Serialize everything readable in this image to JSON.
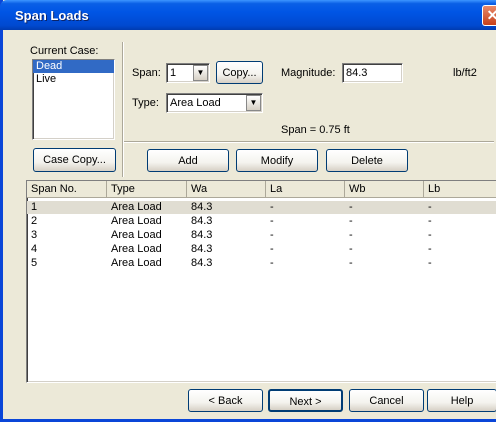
{
  "window": {
    "title": "Span Loads",
    "close_glyph": "✕"
  },
  "case": {
    "label": "Current Case:",
    "items": [
      "Dead",
      "Live"
    ],
    "selected": "Dead",
    "copy_button": "Case Copy..."
  },
  "span": {
    "label": "Span:",
    "value": "1",
    "copy_button": "Copy..."
  },
  "magnitude": {
    "label": "Magnitude:",
    "value": "84.3",
    "unit": "lb/ft2"
  },
  "type": {
    "label": "Type:",
    "value": "Area Load"
  },
  "span_info": "Span = 0.75 ft",
  "actions": {
    "add": "Add",
    "modify": "Modify",
    "delete": "Delete"
  },
  "table": {
    "headers": [
      "Span No.",
      "Type",
      "Wa",
      "La",
      "Wb",
      "Lb"
    ],
    "rows": [
      [
        "1",
        "Area Load",
        "84.3",
        "-",
        "-",
        "-"
      ],
      [
        "2",
        "Area Load",
        "84.3",
        "-",
        "-",
        "-"
      ],
      [
        "3",
        "Area Load",
        "84.3",
        "-",
        "-",
        "-"
      ],
      [
        "4",
        "Area Load",
        "84.3",
        "-",
        "-",
        "-"
      ],
      [
        "5",
        "Area Load",
        "84.3",
        "-",
        "-",
        "-"
      ]
    ]
  },
  "nav": {
    "back": "< Back",
    "next": "Next >",
    "cancel": "Cancel",
    "help": "Help"
  },
  "icons": {
    "close": "close-icon",
    "dropdown": "chevron-down-icon"
  }
}
